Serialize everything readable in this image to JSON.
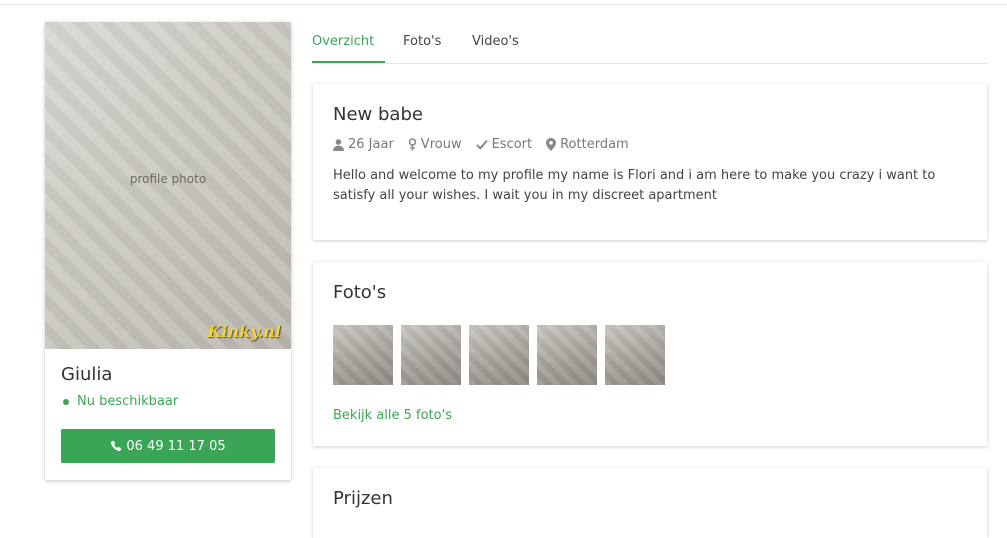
{
  "profile": {
    "name": "Giulia",
    "status": "Nu beschikbaar",
    "phone": "06 49 11 17 05",
    "watermark": "Kinky.nl",
    "photo_caption": "profile photo",
    "accent_color": "#3aa655"
  },
  "tabs": [
    {
      "label": "Overzicht",
      "active": true
    },
    {
      "label": "Foto's",
      "active": false
    },
    {
      "label": "Video's",
      "active": false
    }
  ],
  "overview": {
    "title": "New babe",
    "meta": [
      {
        "icon": "user-icon",
        "label": "26 Jaar"
      },
      {
        "icon": "venus-icon",
        "label": "Vrouw"
      },
      {
        "icon": "check-icon",
        "label": "Escort"
      },
      {
        "icon": "map-marker-icon",
        "label": "Rotterdam"
      }
    ],
    "description": "Hello and welcome to my profile my name is Flori and i am here to make you crazy i want to satisfy all your wishes. I wait you in my discreet apartment"
  },
  "photos": {
    "title": "Foto's",
    "thumbnail_count": 5,
    "view_all_label": "Bekijk alle 5 foto's"
  },
  "prices": {
    "title": "Prijzen"
  }
}
